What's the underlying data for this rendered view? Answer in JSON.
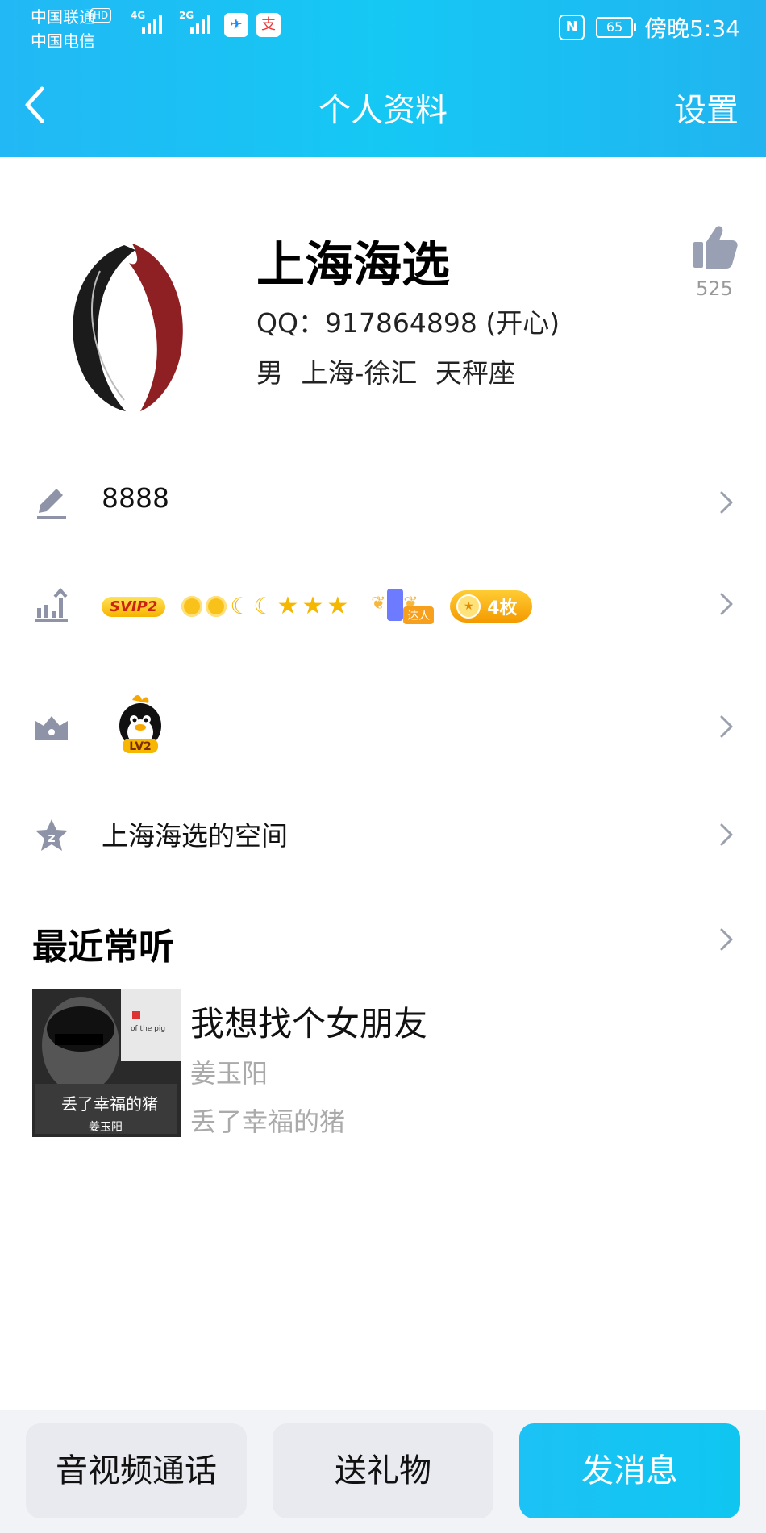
{
  "status_bar": {
    "carrier1": "中国联通",
    "carrier2": "中国电信",
    "hd": "HD",
    "net1": "4G",
    "net2": "2G",
    "battery": "65",
    "time": "傍晚5:34"
  },
  "nav": {
    "title": "个人资料",
    "settings_label": "设置"
  },
  "profile": {
    "name": "上海海选",
    "qq_line": "QQ：917864898 (开心)",
    "info_line": "男 上海-徐汇 天秤座",
    "likes": "525"
  },
  "rows": {
    "signature": "8888",
    "level_badges": {
      "svip": "SVIP2",
      "daren_tag": "达人",
      "medal_count": "4枚"
    },
    "pet_level": "LV2",
    "space": "上海海选的空间"
  },
  "recent": {
    "title": "最近常听",
    "song": {
      "title": "我想找个女朋友",
      "artist": "姜玉阳",
      "album": "丢了幸福的猪",
      "cover_text_en": "of the pig",
      "cover_text_cn": "丢了幸福的猪",
      "cover_artist": "姜玉阳"
    }
  },
  "bottom_bar": {
    "call_label": "音视频通话",
    "gift_label": "送礼物",
    "message_label": "发消息"
  },
  "colors": {
    "accent": "#15c8f4",
    "medal": "#f5a000"
  }
}
